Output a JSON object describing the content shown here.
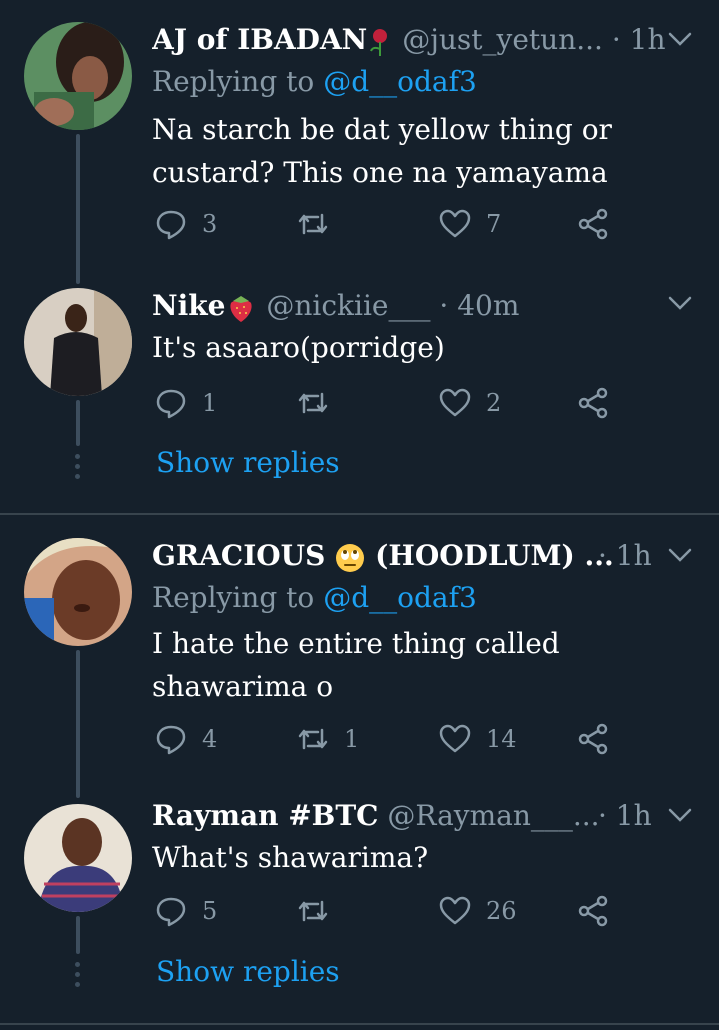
{
  "tweets": [
    {
      "name": "AJ of IBADAN",
      "name_emoji": "rose-icon",
      "handle": "@just_yetun...",
      "time": "· 1h",
      "replying_prefix": "Replying to",
      "replying_to": "@d__odaf3",
      "text_lines": [
        "Na starch be dat yellow thing or",
        "custard? This one na yamayama"
      ],
      "reply_count": "3",
      "retweet_count": "",
      "like_count": "7"
    },
    {
      "name": "Nike",
      "name_emoji": "strawberry-icon",
      "handle": "@nickiie___",
      "time": "· 40m",
      "text_lines": [
        "It's asaaro(porridge)"
      ],
      "reply_count": "1",
      "retweet_count": "",
      "like_count": "2",
      "show_replies": "Show replies"
    },
    {
      "name": "GRACIOUS",
      "name_emoji": "eye-roll-face-icon",
      "name_suffix": "(HOODLUM) ...",
      "handle": "",
      "time": "· 1h",
      "replying_prefix": "Replying to",
      "replying_to": "@d__odaf3",
      "text_lines": [
        "I hate the entire thing called",
        "shawarima o"
      ],
      "reply_count": "4",
      "retweet_count": "1",
      "like_count": "14"
    },
    {
      "name": "Rayman #BTC",
      "handle": "@Rayman___...",
      "time": "· 1h",
      "text_lines": [
        "What's shawarima?"
      ],
      "reply_count": "5",
      "retweet_count": "",
      "like_count": "26",
      "show_replies": "Show replies"
    }
  ],
  "colors": {
    "background": "#15202b",
    "muted": "#8899a6",
    "accent": "#1da1f2",
    "thread_line": "#3d4e5e",
    "divider": "#38444d"
  }
}
